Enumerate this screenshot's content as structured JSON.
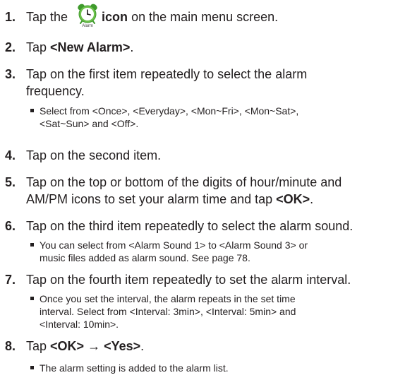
{
  "steps": [
    {
      "num": "1.",
      "pre": "Tap the",
      "icon_name": "alarm-clock-icon",
      "icon_caption": "Alarm",
      "bold": "icon",
      "post": " on the main menu screen."
    },
    {
      "num": "2.",
      "pre": "Tap ",
      "bold": "<New Alarm>",
      "post": "."
    },
    {
      "num": "3.",
      "line1": "Tap on the first item repeatedly to select the alarm",
      "line2": "frequency.",
      "sub": [
        {
          "line1": "Select from <Once>, <Everyday>, <Mon~Fri>, <Mon~Sat>,",
          "line2": "<Sat~Sun> and <Off>."
        }
      ]
    },
    {
      "num": "4.",
      "text": "Tap on the second item."
    },
    {
      "num": "5.",
      "line1": "Tap on the top or bottom of the digits of hour/minute and",
      "line2_pre": "AM/PM icons to set your alarm time and tap ",
      "line2_bold": "<OK>",
      "line2_post": "."
    },
    {
      "num": "6.",
      "text": "Tap on the third item repeatedly to select the alarm sound.",
      "sub": [
        {
          "line1": "You can select from <Alarm Sound 1> to <Alarm Sound 3> or",
          "line2": "music files added as alarm sound. See page 78."
        }
      ]
    },
    {
      "num": "7.",
      "text": "Tap on the fourth item repeatedly to set the alarm interval.",
      "sub": [
        {
          "line1": "Once you set the interval, the alarm repeats in the set time",
          "line2": "interval. Select from <Interval: 3min>, <Interval: 5min> and",
          "line3": "<Interval: 10min>."
        }
      ]
    },
    {
      "num": "8.",
      "pre": "Tap ",
      "bold1": "<OK>",
      "arrow": " → ",
      "bold2": "<Yes>",
      "post": ".",
      "sub": [
        {
          "line1": "The alarm setting is added to the alarm list."
        }
      ]
    }
  ],
  "colors": {
    "text": "#231f20",
    "icon_green": "#6cc04a",
    "icon_face": "#ffffff"
  }
}
